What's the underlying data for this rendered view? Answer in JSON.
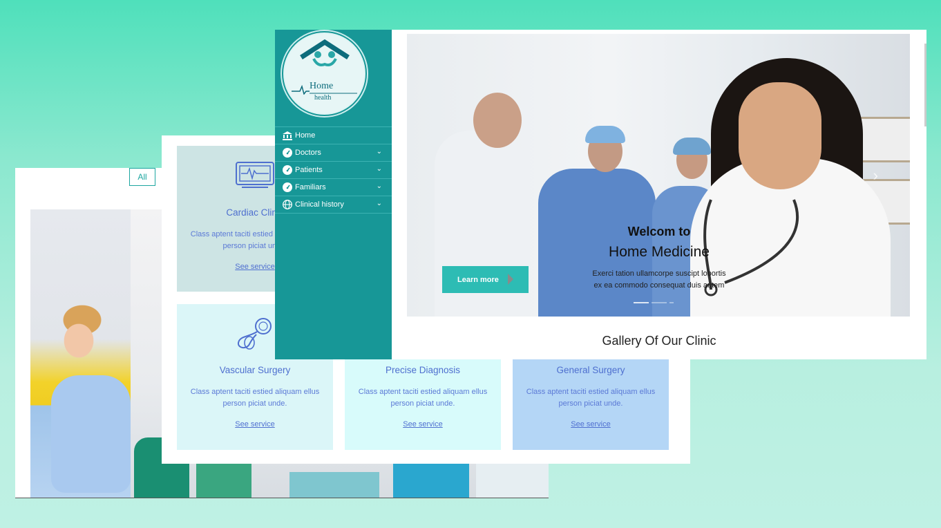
{
  "gallery": {
    "filter_all": "All"
  },
  "services": {
    "items": [
      {
        "title": "Cardiac Clinic",
        "desc": "Class aptent taciti estied aliquam ellus person piciat unde.",
        "link": "See service",
        "bg": "#cde4e4"
      },
      {
        "title": "Vascular Surgery",
        "desc": "Class aptent taciti estied aliquam ellus person piciat unde.",
        "link": "See service",
        "bg": "#dbf6f8"
      },
      {
        "title": "Precise Diagnosis",
        "desc": "Class aptent taciti estied aliquam ellus person piciat unde.",
        "link": "See service",
        "bg": "#d8fbfb"
      },
      {
        "title": "General Surgery",
        "desc": "Class aptent taciti estied aliquam ellus person piciat unde.",
        "link": "See service",
        "bg": "#b4d6f6"
      }
    ]
  },
  "logo": {
    "line1": "Home",
    "line2": "health"
  },
  "sidebar": {
    "items": [
      {
        "label": "Home",
        "icon": "bank-icon"
      },
      {
        "label": "Doctors",
        "icon": "dashboard-icon"
      },
      {
        "label": "Patients",
        "icon": "dashboard-icon"
      },
      {
        "label": "Familiars",
        "icon": "dashboard-icon"
      },
      {
        "label": "Clinical history",
        "icon": "globe-icon"
      }
    ]
  },
  "hero": {
    "welcome": "Welcom to",
    "brand": "Home Medicine",
    "subtitle_line1": "Exerci tation ullamcorpe suscipt lobortis",
    "subtitle_line2": "ex ea commodo consequat duis autem",
    "cta": "Learn more"
  },
  "gallery_title": "Gallery Of Our Clinic",
  "colors": {
    "accent": "#179797",
    "button": "#2dbcb4",
    "service_text": "#4e6fcf"
  }
}
